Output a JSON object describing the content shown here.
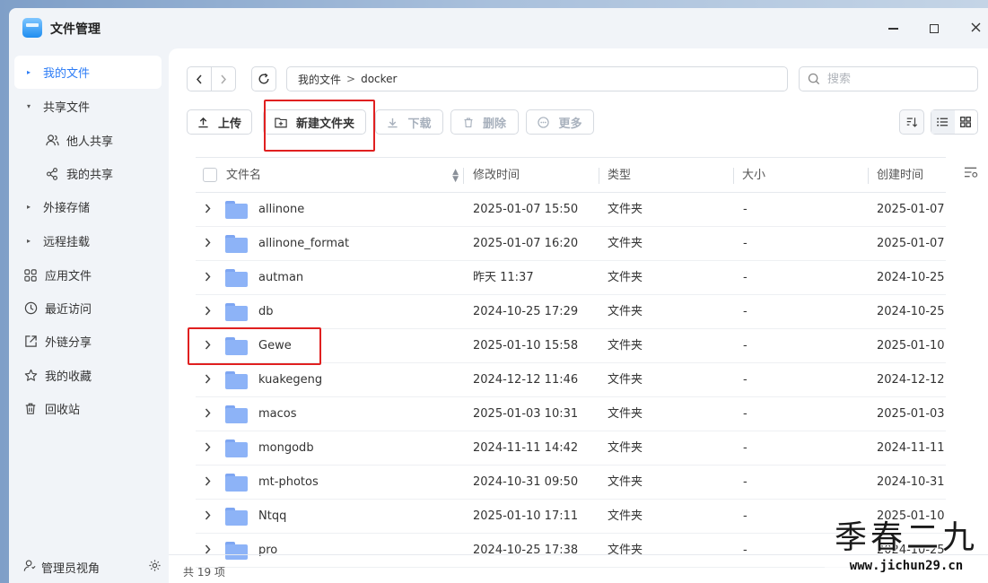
{
  "app": {
    "title": "文件管理"
  },
  "sidebar": {
    "items": [
      {
        "label": "我的文件",
        "icon": "caret-right-icon",
        "active": true
      },
      {
        "label": "共享文件",
        "icon": "caret-down-icon"
      },
      {
        "label": "他人共享",
        "icon": "users-icon"
      },
      {
        "label": "我的共享",
        "icon": "share-icon"
      },
      {
        "label": "外接存储",
        "icon": "caret-right-icon"
      },
      {
        "label": "远程挂载",
        "icon": "caret-right-icon"
      },
      {
        "label": "应用文件",
        "icon": "apps-icon"
      },
      {
        "label": "最近访问",
        "icon": "clock-icon"
      },
      {
        "label": "外链分享",
        "icon": "external-link-icon"
      },
      {
        "label": "我的收藏",
        "icon": "star-icon"
      },
      {
        "label": "回收站",
        "icon": "trash-icon"
      }
    ],
    "bottom": {
      "label": "管理员视角"
    }
  },
  "path": {
    "root": "我的文件",
    "sep": ">",
    "current": "docker"
  },
  "search": {
    "placeholder": "搜索"
  },
  "toolbar": {
    "upload": "上传",
    "new_folder": "新建文件夹",
    "download": "下载",
    "delete": "删除",
    "more": "更多"
  },
  "table": {
    "columns": [
      "文件名",
      "修改时间",
      "类型",
      "大小",
      "创建时间"
    ],
    "rows": [
      {
        "name": "allinone",
        "modified": "2025-01-07 15:50",
        "type": "文件夹",
        "size": "-",
        "created": "2025-01-07"
      },
      {
        "name": "allinone_format",
        "modified": "2025-01-07 16:20",
        "type": "文件夹",
        "size": "-",
        "created": "2025-01-07"
      },
      {
        "name": "autman",
        "modified": "昨天 11:37",
        "type": "文件夹",
        "size": "-",
        "created": "2024-10-25"
      },
      {
        "name": "db",
        "modified": "2024-10-25 17:29",
        "type": "文件夹",
        "size": "-",
        "created": "2024-10-25"
      },
      {
        "name": "Gewe",
        "modified": "2025-01-10 15:58",
        "type": "文件夹",
        "size": "-",
        "created": "2025-01-10"
      },
      {
        "name": "kuakegeng",
        "modified": "2024-12-12 11:46",
        "type": "文件夹",
        "size": "-",
        "created": "2024-12-12"
      },
      {
        "name": "macos",
        "modified": "2025-01-03 10:31",
        "type": "文件夹",
        "size": "-",
        "created": "2025-01-03"
      },
      {
        "name": "mongodb",
        "modified": "2024-11-11 14:42",
        "type": "文件夹",
        "size": "-",
        "created": "2024-11-11"
      },
      {
        "name": "mt-photos",
        "modified": "2024-10-31 09:50",
        "type": "文件夹",
        "size": "-",
        "created": "2024-10-31"
      },
      {
        "name": "Ntqq",
        "modified": "2025-01-10 17:11",
        "type": "文件夹",
        "size": "-",
        "created": "2025-01-10"
      },
      {
        "name": "pro",
        "modified": "2024-10-25 17:38",
        "type": "文件夹",
        "size": "-",
        "created": "2024-10-25"
      }
    ]
  },
  "footer": {
    "count": "共 19 项"
  },
  "watermark": {
    "line1": "季春二九",
    "line2": "www.jichun29.cn"
  },
  "colors": {
    "accent": "#2c7cf6",
    "highlight": "#e02020",
    "folder": "#8db3f7"
  }
}
